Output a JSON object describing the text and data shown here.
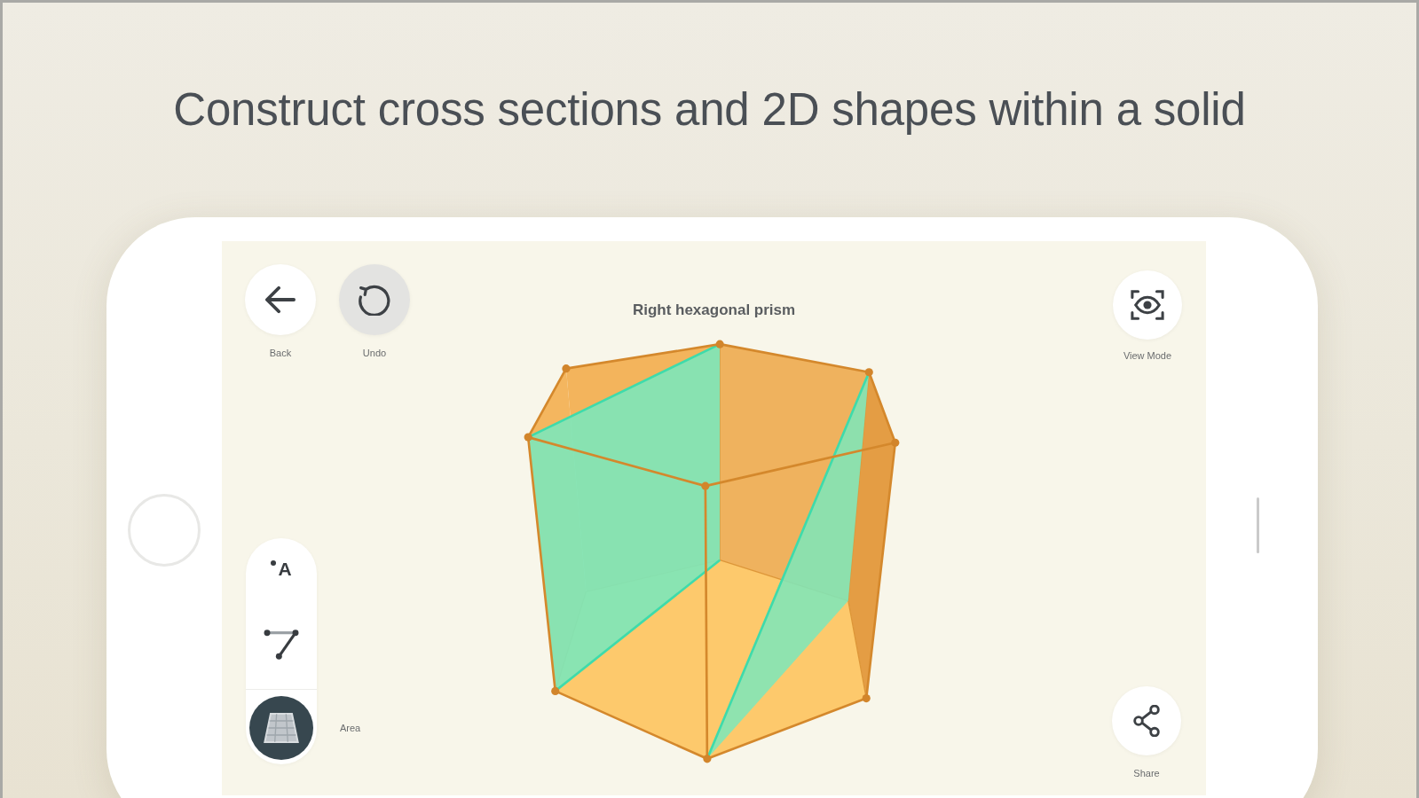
{
  "headline": "Construct cross sections and 2D shapes within a solid",
  "app": {
    "top_buttons": [
      {
        "kind": "back",
        "label": "Back",
        "disabled": false
      },
      {
        "kind": "undo",
        "label": "Undo",
        "disabled": true
      }
    ],
    "title": "Right hexagonal prism",
    "view_mode": {
      "label": "View Mode"
    },
    "tools": [
      {
        "kind": "label",
        "glyph": "A",
        "selected": false
      },
      {
        "kind": "segment",
        "selected": false
      },
      {
        "kind": "area",
        "label": "Area",
        "selected": true
      }
    ],
    "share": {
      "label": "Share"
    }
  }
}
